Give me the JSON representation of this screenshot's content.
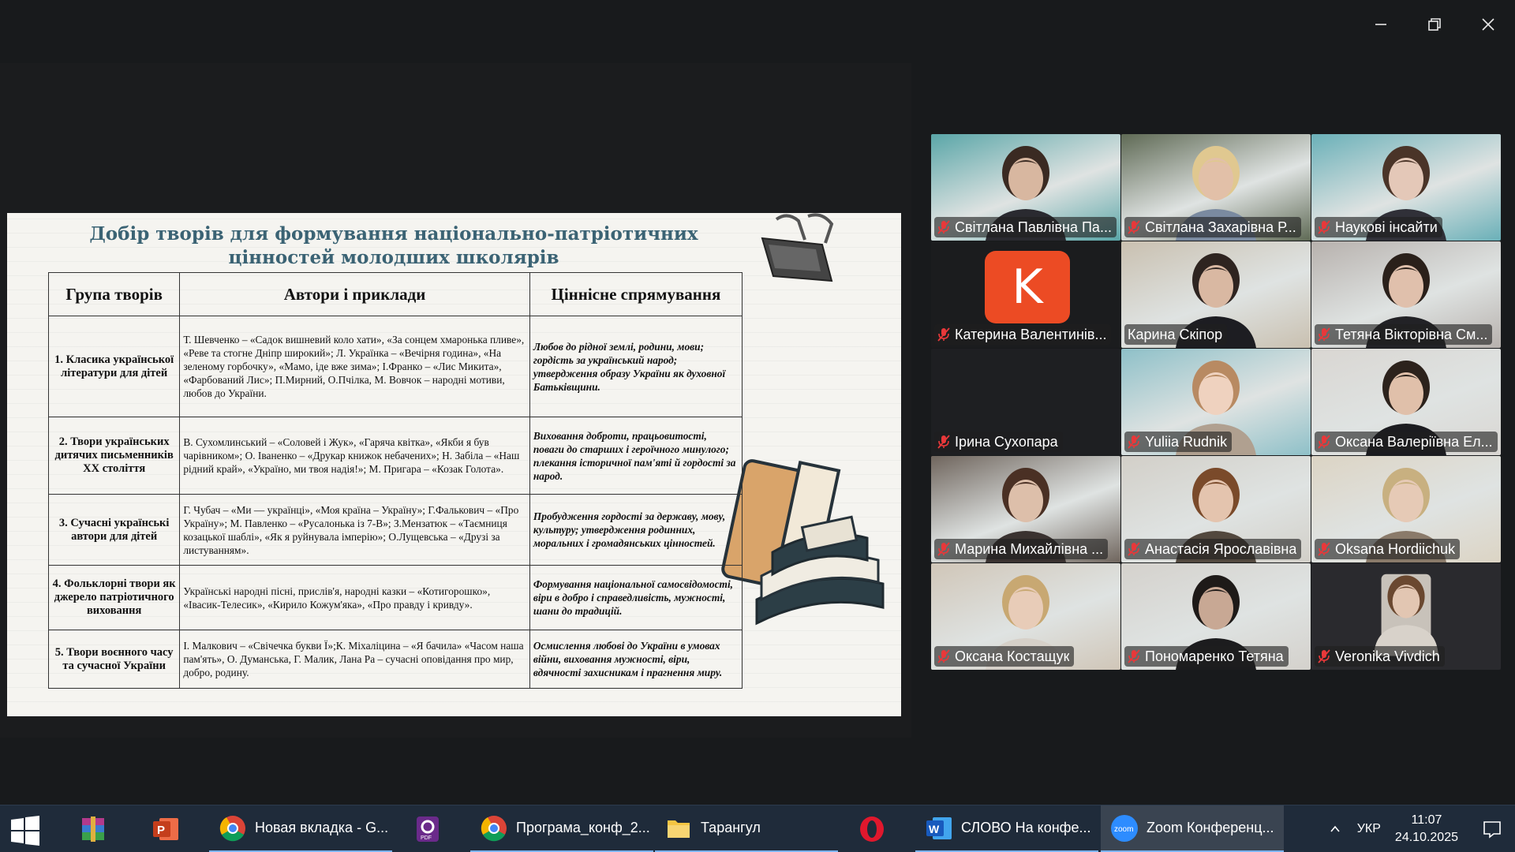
{
  "window": {
    "controls": [
      "minimize",
      "restore",
      "close"
    ]
  },
  "slide": {
    "title_line1": "Добір творів для формування національно-патріотичних",
    "title_line2": "цінностей молодших школярів",
    "headers": [
      "Група творів",
      "Автори і приклади",
      "Ціннісне спрямування"
    ],
    "rows": [
      {
        "group": "1. Класика української літератури для дітей",
        "authors": "Т. Шевченко – «Садок вишневий коло хати», «За сонцем хмаронька пливе», «Реве та стогне Дніпр широкий»; Л. Українка – «Вечірня година», «На зеленому горбочку», «Мамо, іде вже зима»; І.Франко – «Лис Микита», «Фарбований Лис»; П.Мирний, О.Пчілка, М. Вовчок – народні мотиви, любов до України.",
        "values": "Любов до рідної землі, родини, мови; гордість за український народ; утвердження образу України як духовної Батьківщини."
      },
      {
        "group": "2. Твори українських дитячих письменників XX століття",
        "authors": "В. Сухомлинський – «Соловей і Жук», «Гаряча квітка», «Якби я був чарівником»; О. Іваненко – «Друкар книжок небачених»; Н. Забіла – «Наш рідний край», «Україно, ми твоя надія!»; М. Пригара – «Козак Голота».",
        "values": "Виховання доброти, працьовитості, поваги до старших і героїчного минулого; плекання історичної пам'яті й гордості за народ."
      },
      {
        "group": "3. Сучасні українські автори для дітей",
        "authors": "Г. Чубач – «Ми — українці», «Моя країна – Україну»; Г.Фалькович – «Про Україну»; М. Павленко – «Русалонька із 7-В»; З.Мензатюк – «Таємниця козацької шаблі», «Як я руйнувала імперію»; О.Лущевська – «Друзі за листуванням».",
        "values": "Пробудження гордості за державу, мову, культуру; утвердження родинних, моральних і громадянських цінностей."
      },
      {
        "group": "4. Фольклорні твори як джерело патріотичного виховання",
        "authors": "Українські народні пісні, прислів'я, народні казки – «Котигорошко», «Івасик-Телесик», «Кирило Кожум'яка», «Про правду і кривду».",
        "values": "Формування національної самосвідомості, віри в добро і справедливість, мужності, шани до традицій."
      },
      {
        "group": "5. Твори воєнного часу та сучасної України",
        "authors": "І. Малкович – «Свічечка букви Ї»;К. Міхаліцина – «Я бачила» «Часом наша пам'ять», О. Думанська, Г. Малик, Лана Ра – сучасні оповідання про мир, добро, родину.",
        "values": "Осмислення любові до України в умовах війни, виховання мужності, віри, вдячності захисникам і прагнення миру."
      }
    ]
  },
  "participants": [
    {
      "name": "Світлана Павлівна Па...",
      "muted": true,
      "speaking": false,
      "bg": "#5aa6a8",
      "skin": "#d8b7a0",
      "hair": "#3a2a22",
      "shirt": "#2a2a30"
    },
    {
      "name": "Світлана Захарівна Р...",
      "muted": true,
      "speaking": false,
      "bg": "#5f6a55",
      "skin": "#e2c0a8",
      "hair": "#e0c890",
      "shirt": "#7a8aa0"
    },
    {
      "name": "Наукові інсайти",
      "muted": true,
      "speaking": false,
      "bg": "#6ab0b8",
      "skin": "#e4c8b8",
      "hair": "#4a3428",
      "shirt": "#303038"
    },
    {
      "name": "Катерина Валентинів...",
      "muted": true,
      "speaking": false,
      "avatar_letter": "K"
    },
    {
      "name": "Карина Скіпор",
      "muted": false,
      "speaking": true,
      "bg": "#c9c0b0",
      "skin": "#d9b8a2",
      "hair": "#2e2420",
      "shirt": "#1d1d22"
    },
    {
      "name": "Тетяна Вікторівна См...",
      "muted": true,
      "speaking": false,
      "bg": "#b7b1ad",
      "skin": "#e0c0ac",
      "hair": "#2a201a",
      "shirt": "#222226"
    },
    {
      "name": "Ірина Сухопара",
      "muted": true,
      "speaking": false,
      "blank": true
    },
    {
      "name": "Yuliia Rudnik",
      "muted": true,
      "speaking": false,
      "bg": "#8ec0c8",
      "skin": "#efd2bf",
      "hair": "#b88a62",
      "shirt": "#b0a090"
    },
    {
      "name": "Оксана Валеріївна Ел...",
      "muted": true,
      "speaking": false,
      "bg": "#d9d6d2",
      "skin": "#e0c0aa",
      "hair": "#2c221c",
      "shirt": "#1c1c20"
    },
    {
      "name": "Марина Михайлівна ...",
      "muted": true,
      "speaking": false,
      "bg": "#6f655d",
      "skin": "#ddbfaa",
      "hair": "#4a3024",
      "shirt": "#3a3230"
    },
    {
      "name": "Анастасія Ярославівна",
      "muted": true,
      "speaking": false,
      "bg": "#d2cfc8",
      "skin": "#e4c4ae",
      "hair": "#7a4a2a",
      "shirt": "#52483e"
    },
    {
      "name": "Oksana Hordiichuk",
      "muted": true,
      "speaking": false,
      "bg": "#dcd4c4",
      "skin": "#e6cab6",
      "hair": "#c8b080",
      "shirt": "#8a7a6a"
    },
    {
      "name": "Оксана Костащук",
      "muted": true,
      "speaking": false,
      "bg": "#d0c6b8",
      "skin": "#e8ccb8",
      "hair": "#c8a872",
      "shirt": "#d6d0c8"
    },
    {
      "name": "Пономаренко Тетяна",
      "muted": true,
      "speaking": false,
      "bg": "#d4d1cc",
      "skin": "#c8a894",
      "hair": "#1e1a18",
      "shirt": "#1c1c1e"
    },
    {
      "name": "Veronika Vivdich",
      "muted": true,
      "speaking": false,
      "bg": "#2a2a2e",
      "skin": "#e2c6b2",
      "hair": "#6a4830",
      "shirt": "#d8d2ca",
      "small": true
    }
  ],
  "taskbar": {
    "items": [
      {
        "label": "",
        "icon": "winrar-icon"
      },
      {
        "label": "",
        "icon": "powerpoint-icon"
      },
      {
        "label": "Новая вкладка - G...",
        "icon": "chrome-icon"
      },
      {
        "label": "",
        "icon": "pdf-icon"
      },
      {
        "label": "Програма_конф_2...",
        "icon": "chrome-icon"
      },
      {
        "label": "Тарангул",
        "icon": "folder-icon"
      },
      {
        "label": "",
        "icon": "opera-icon"
      },
      {
        "label": "СЛОВО На конфе...",
        "icon": "word-icon"
      },
      {
        "label": "Zoom Конференц...",
        "icon": "zoom-icon"
      }
    ],
    "language": "УКР",
    "time": "11:07",
    "date": "24.10.2025"
  },
  "colors": {
    "background": "#181a1c",
    "taskbar": "#1f2b3a",
    "speaking_outline": "#23d959",
    "slide_title": "#3b6374",
    "muted_red": "#e8383a"
  }
}
